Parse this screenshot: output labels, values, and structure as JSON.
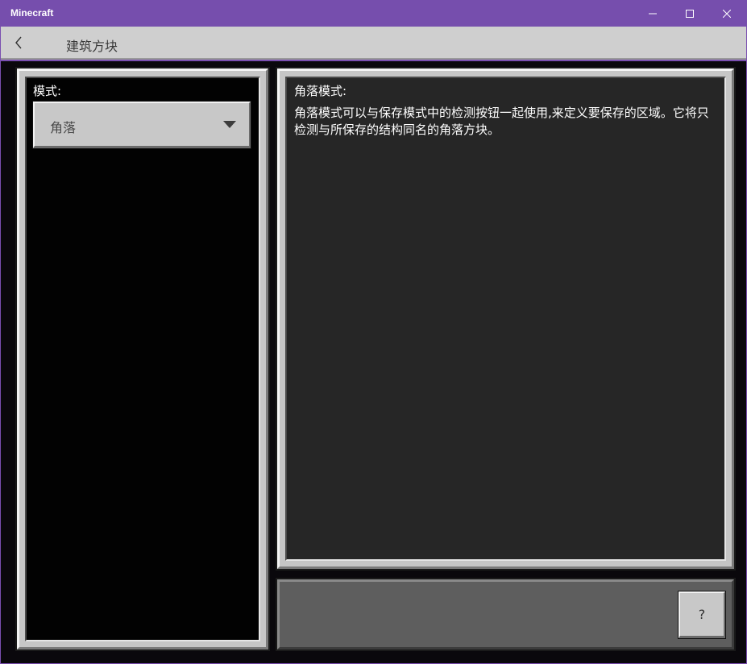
{
  "window": {
    "title": "Minecraft",
    "titlebar_color": "#764ead"
  },
  "header": {
    "back_icon": "chevron-left-icon",
    "title": "建筑方块"
  },
  "left_panel": {
    "mode_label": "模式:",
    "mode_select": {
      "value": "角落",
      "icon": "triangle-down-icon"
    }
  },
  "right_panel": {
    "title": "角落模式:",
    "description": "角落模式可以与保存模式中的检测按钮一起使用,来定义要保存的区域。它将只检测与所保存的结构同名的角落方块。"
  },
  "bottom_bar": {
    "help_label": "?"
  }
}
